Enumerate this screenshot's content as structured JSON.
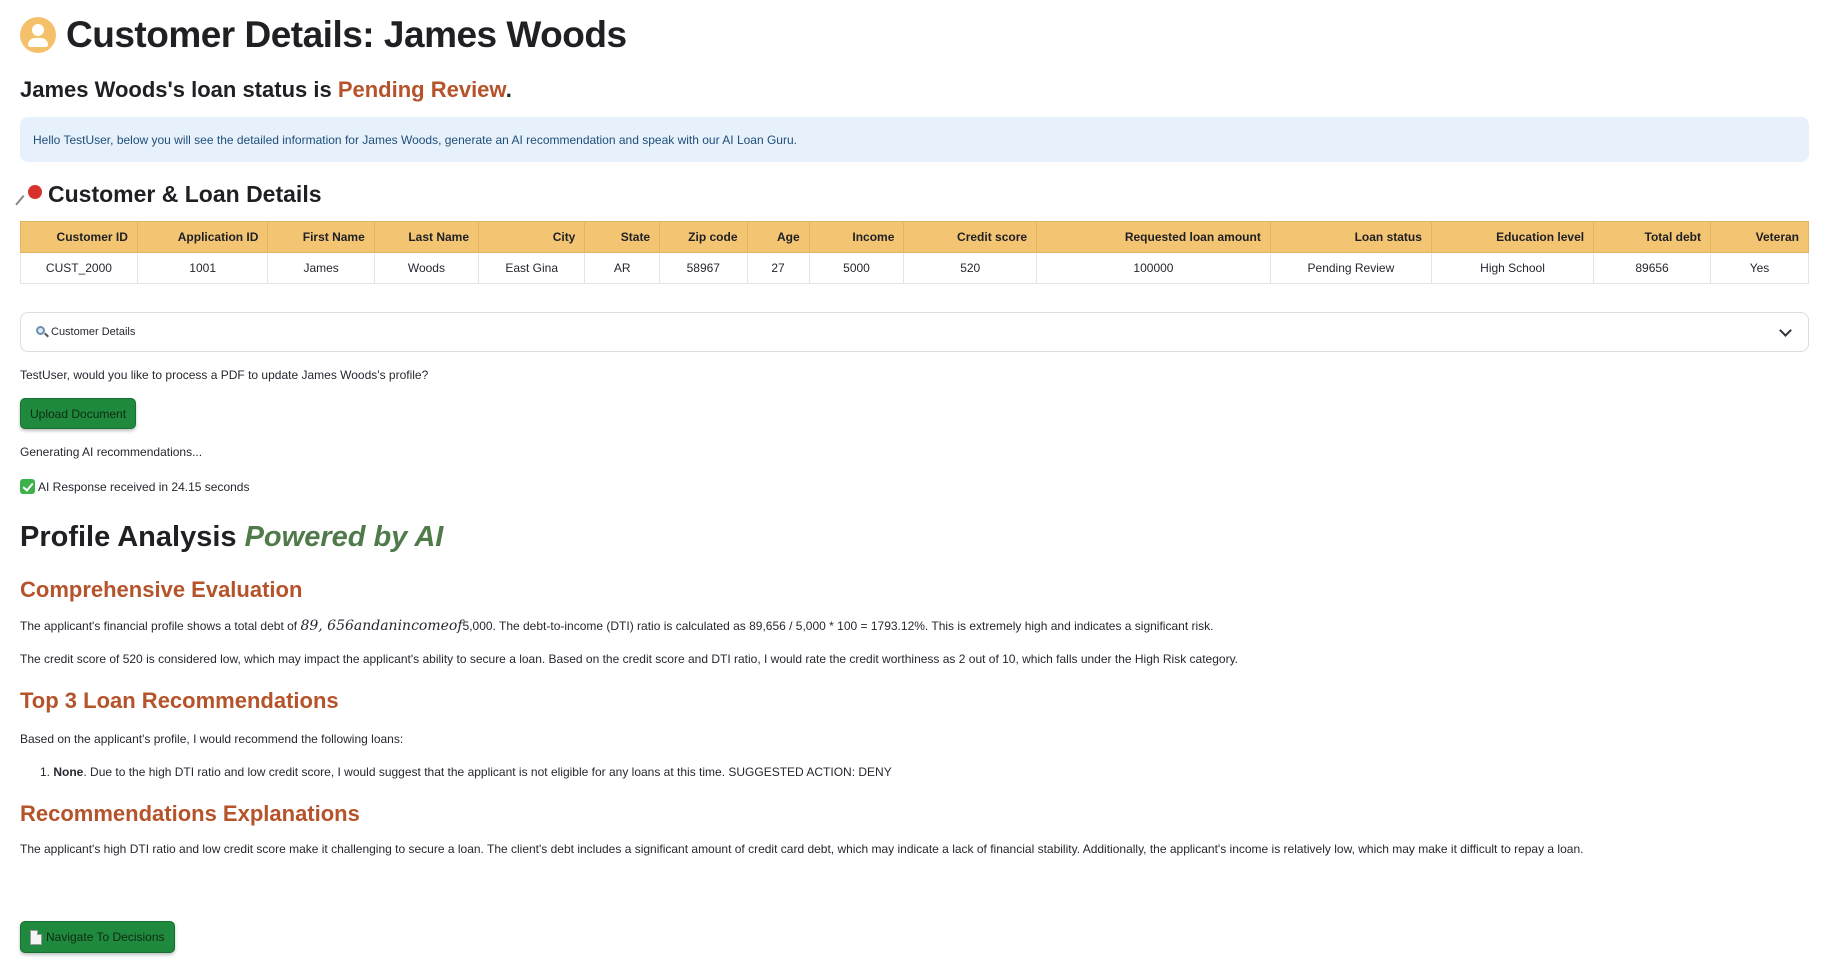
{
  "header": {
    "title": "Customer Details: James Woods",
    "status_prefix": "James Woods's loan status is ",
    "status_value": "Pending Review",
    "status_suffix": "."
  },
  "info": {
    "message": "Hello TestUser, below you will see the detailed information for James Woods, generate an AI recommendation and speak with our AI Loan Guru."
  },
  "details_section": {
    "title": "Customer & Loan Details"
  },
  "table": {
    "columns": [
      "Customer ID",
      "Application ID",
      "First Name",
      "Last Name",
      "City",
      "State",
      "Zip code",
      "Age",
      "Income",
      "Credit score",
      "Requested loan amount",
      "Loan status",
      "Education level",
      "Total debt",
      "Veteran"
    ],
    "row": [
      "CUST_2000",
      "1001",
      "James",
      "Woods",
      "East Gina",
      "AR",
      "58967",
      "27",
      "5000",
      "520",
      "100000",
      "Pending Review",
      "High School",
      "89656",
      "Yes"
    ]
  },
  "expander": {
    "label": "Customer Details"
  },
  "upload": {
    "prompt": "TestUser, would you like to process a PDF to update James Woods's profile?",
    "button_label": "Upload Document"
  },
  "ai_status": {
    "generating": "Generating AI recommendations...",
    "response": "AI Response received in 24.15 seconds"
  },
  "analysis": {
    "title_main": "Profile Analysis ",
    "title_accent": "Powered by AI",
    "comprehensive": {
      "heading": "Comprehensive Evaluation",
      "p1_start": "The applicant's financial profile shows a total debt of ",
      "p1_math": "89, 656andanincomeof",
      "p1_end": "5,000. The debt-to-income (DTI) ratio is calculated as 89,656 / 5,000 * 100 = 1793.12%. This is extremely high and indicates a significant risk.",
      "p2": "The credit score of 520 is considered low, which may impact the applicant's ability to secure a loan. Based on the credit score and DTI ratio, I would rate the credit worthiness as 2 out of 10, which falls under the High Risk category."
    },
    "top3": {
      "heading": "Top 3 Loan Recommendations",
      "intro": "Based on the applicant's profile, I would recommend the following loans:",
      "item_number": "1.",
      "item_bold": "None",
      "item_text": ". Due to the high DTI ratio and low credit score, I would suggest that the applicant is not eligible for any loans at this time. SUGGESTED ACTION: DENY"
    },
    "explanations": {
      "heading": "Recommendations Explanations",
      "text": "The applicant's high DTI ratio and low credit score make it challenging to secure a loan. The client's debt includes a significant amount of credit card debt, which may indicate a lack of financial stability. Additionally, the applicant's income is relatively low, which may make it difficult to repay a loan."
    }
  },
  "navigation": {
    "button_label": "Navigate To Decisions"
  },
  "icons": {
    "avatar": "user-avatar-icon",
    "pin": "pushpin-icon",
    "search": "magnifier-icon",
    "chevron": "chevron-down-icon",
    "check": "check-mark-icon",
    "doc": "document-icon"
  },
  "colors": {
    "table_header": "#f3c573",
    "accent_rust": "#b5532a",
    "accent_green": "#4f7a4a",
    "button_green": "#1f8a3e",
    "info_bg": "#e6f1fb"
  }
}
